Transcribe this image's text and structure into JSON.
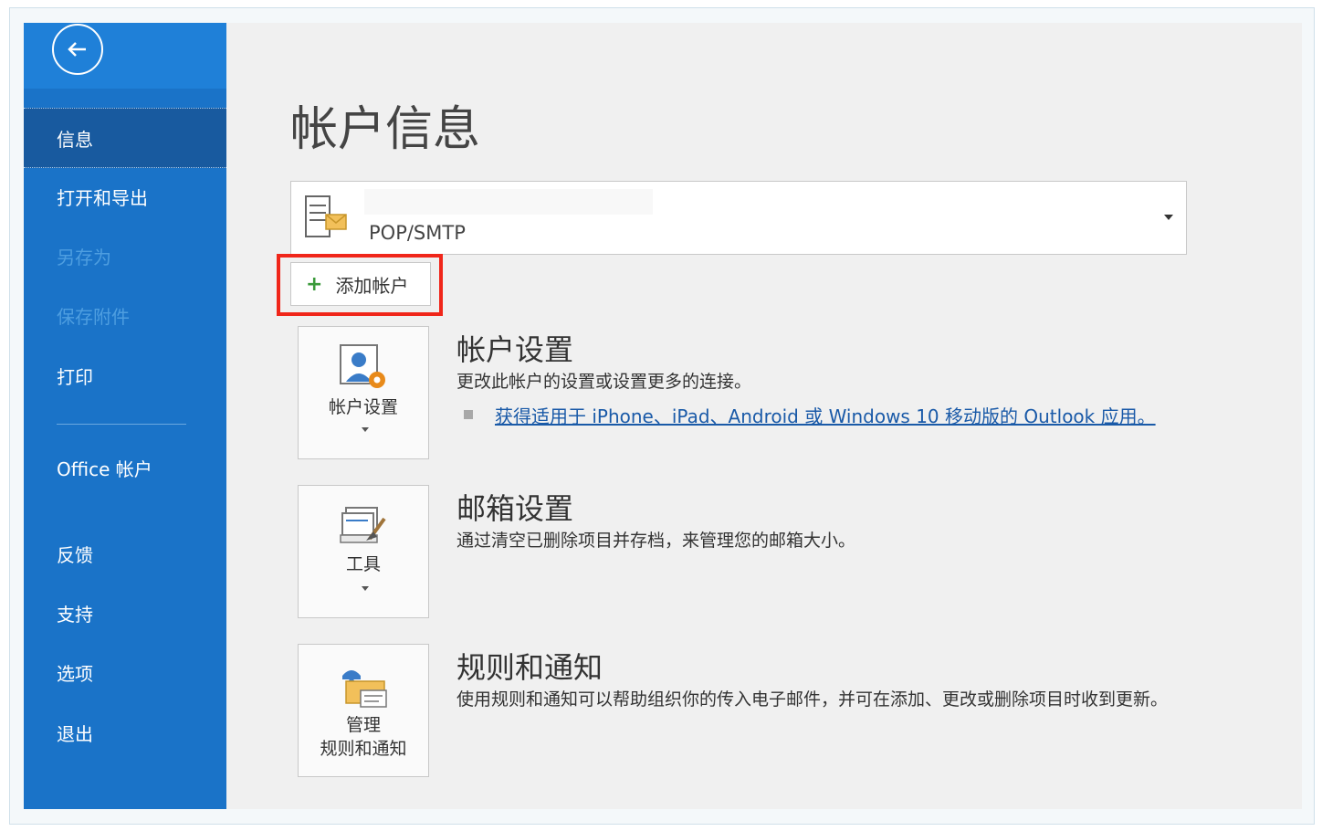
{
  "sidebar": {
    "items": [
      {
        "label": "信息"
      },
      {
        "label": "打开和导出"
      },
      {
        "label": "另存为"
      },
      {
        "label": "保存附件"
      },
      {
        "label": "打印"
      },
      {
        "label": "Office 帐户"
      },
      {
        "label": "反馈"
      },
      {
        "label": "支持"
      },
      {
        "label": "选项"
      },
      {
        "label": "退出"
      }
    ],
    "accent_color": "#1a73c8"
  },
  "main": {
    "title": "帐户信息",
    "account": {
      "type": "POP/SMTP"
    },
    "add_account_label": "添加帐户",
    "sections": [
      {
        "tile_label": "帐户设置",
        "title": "帐户设置",
        "description": "更改此帐户的设置或设置更多的连接。",
        "link": "获得适用于 iPhone、iPad、Android 或 Windows 10 移动版的 Outlook 应用。"
      },
      {
        "tile_label": "工具",
        "title": "邮箱设置",
        "description": "通过清空已删除项目并存档，来管理您的邮箱大小。"
      },
      {
        "tile_label_line1": "管理",
        "tile_label_line2": "规则和通知",
        "title": "规则和通知",
        "description": "使用规则和通知可以帮助组织你的传入电子邮件，并可在添加、更改或删除项目时收到更新。"
      }
    ]
  }
}
